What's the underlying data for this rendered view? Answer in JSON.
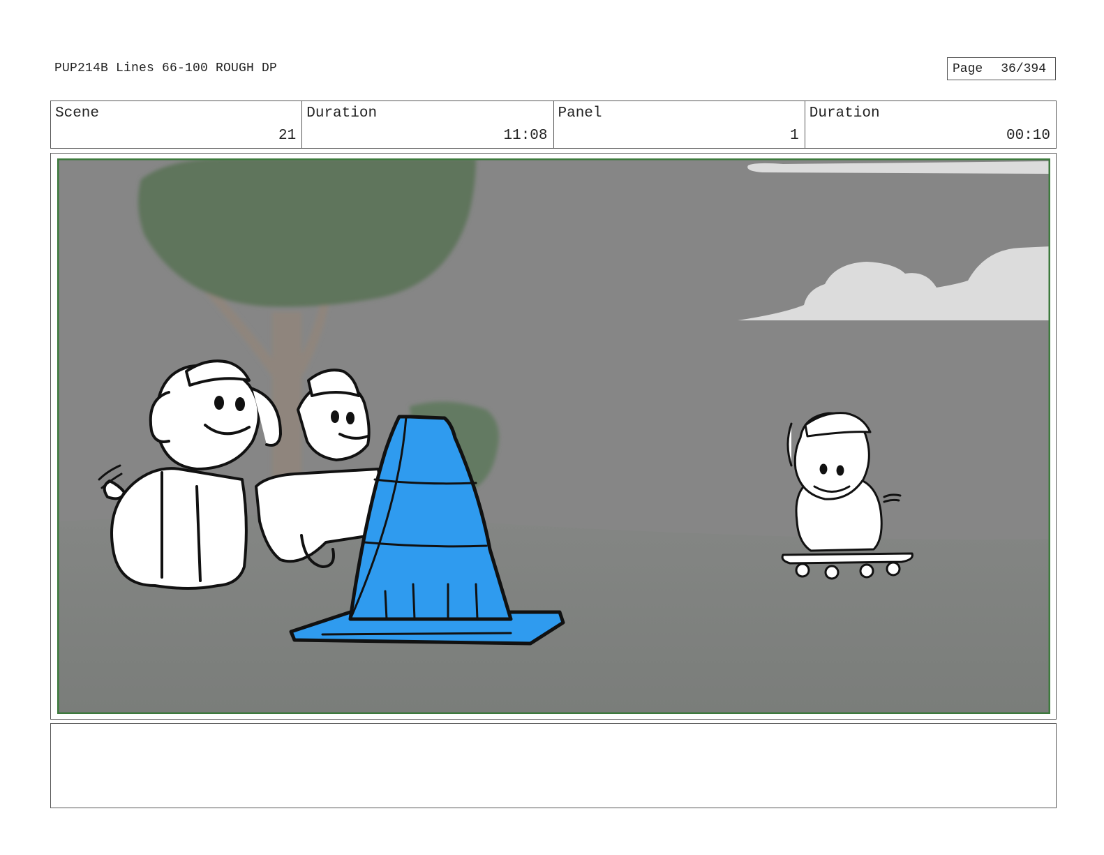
{
  "header": {
    "title": "PUP214B Lines 66-100 ROUGH DP",
    "page_label": "Page",
    "page_value": "36/394"
  },
  "info": {
    "scene_label": "Scene",
    "scene_value": "21",
    "duration_label": "Duration",
    "duration_value": "11:08",
    "panel_label": "Panel",
    "panel_value": "1",
    "panel_duration_label": "Duration",
    "panel_duration_value": "00:10"
  },
  "colors": {
    "panel_border": "#3d7a3d",
    "sky": "#868686",
    "ground": "#7d807d",
    "cone": "#2f9bef",
    "tree": "#5e755c",
    "cloud": "#dcdcdc"
  },
  "notes": {
    "text": ""
  }
}
